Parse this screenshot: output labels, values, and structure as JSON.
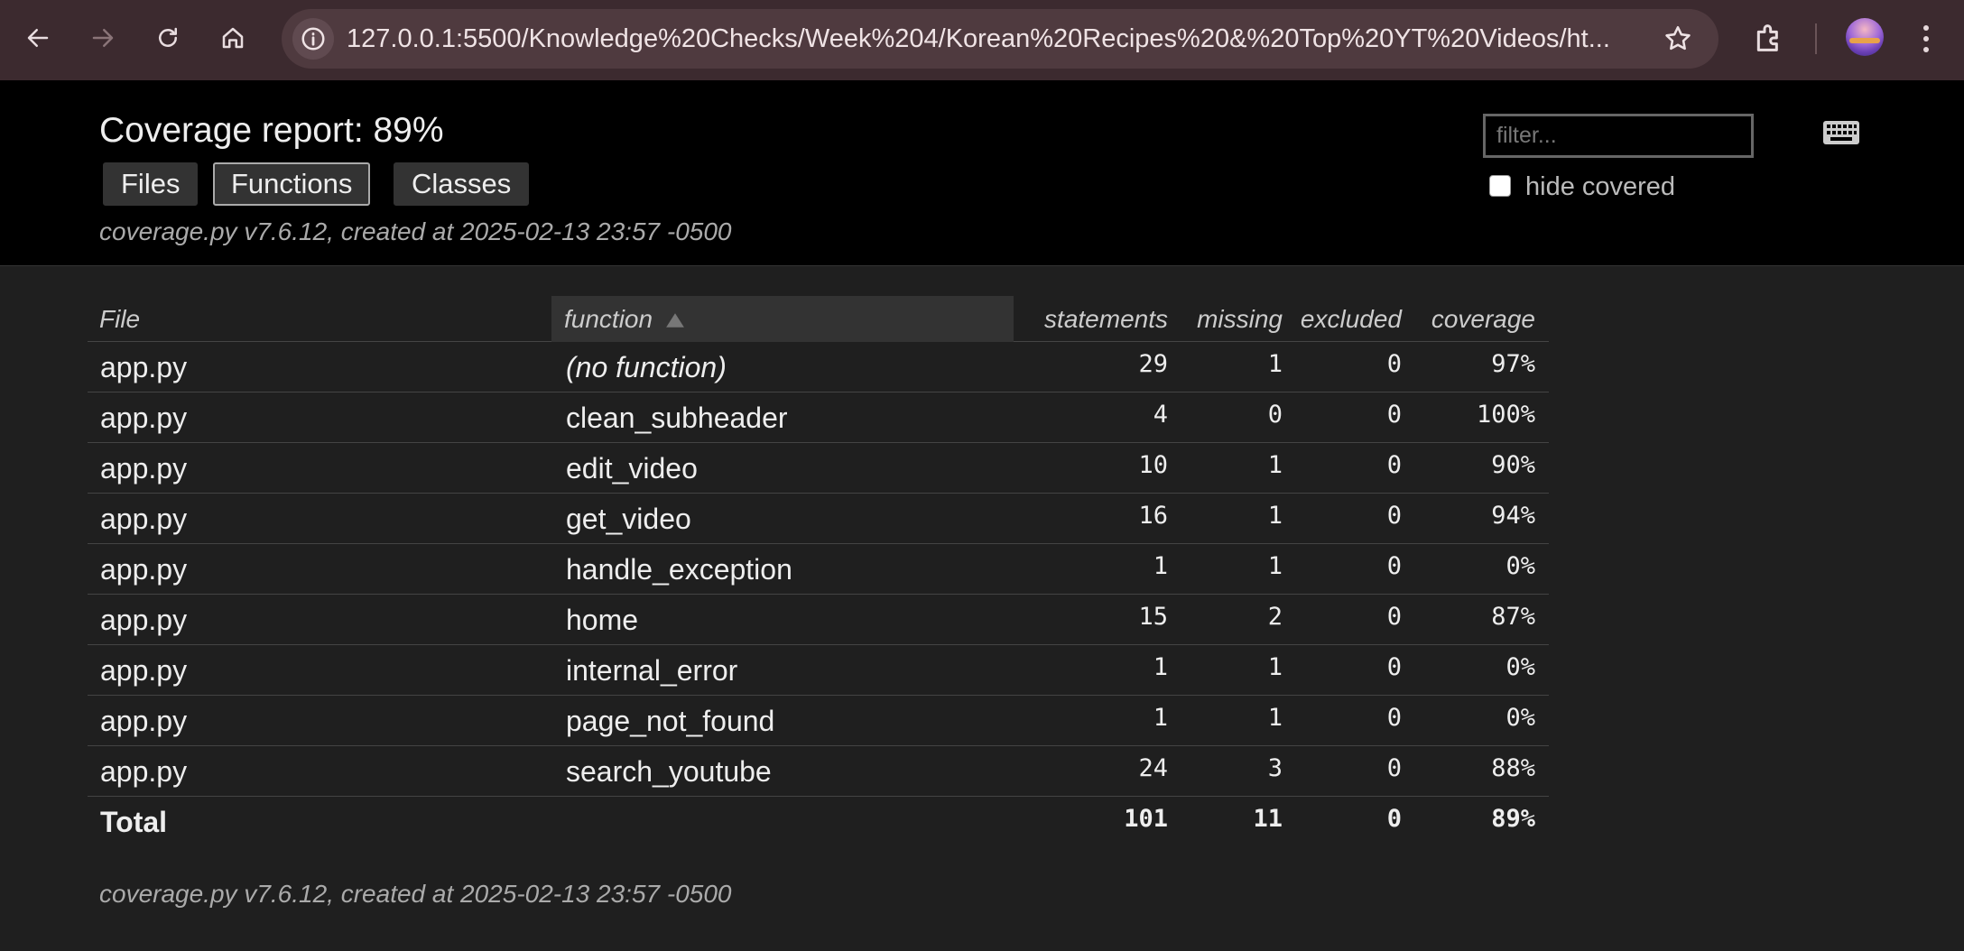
{
  "browser": {
    "url": "127.0.0.1:5500/Knowledge%20Checks/Week%204/Korean%20Recipes%20&%20Top%20YT%20Videos/ht...",
    "icons": [
      "back-arrow-icon",
      "forward-arrow-icon",
      "reload-icon",
      "home-icon",
      "site-info-icon",
      "star-icon",
      "extensions-icon",
      "profile-avatar",
      "more-menu-icon"
    ]
  },
  "header": {
    "title": "Coverage report: 89%",
    "tabs": [
      {
        "label": "Files",
        "current": false
      },
      {
        "label": "Functions",
        "current": true
      },
      {
        "label": "Classes",
        "current": false
      }
    ],
    "meta": "coverage.py v7.6.12, created at 2025-02-13 23:57 -0500",
    "filter_placeholder": "filter...",
    "hide_covered_label": "hide covered",
    "hide_covered_checked": false
  },
  "table": {
    "columns": [
      "File",
      "function",
      "statements",
      "missing",
      "excluded",
      "coverage"
    ],
    "sorted_column": "function",
    "sort_direction": "ascending",
    "rows": [
      {
        "file": "app.py",
        "function": "(no function)",
        "statements": "29",
        "missing": "1",
        "excluded": "0",
        "coverage": "97%"
      },
      {
        "file": "app.py",
        "function": "clean_subheader",
        "statements": "4",
        "missing": "0",
        "excluded": "0",
        "coverage": "100%"
      },
      {
        "file": "app.py",
        "function": "edit_video",
        "statements": "10",
        "missing": "1",
        "excluded": "0",
        "coverage": "90%"
      },
      {
        "file": "app.py",
        "function": "get_video",
        "statements": "16",
        "missing": "1",
        "excluded": "0",
        "coverage": "94%"
      },
      {
        "file": "app.py",
        "function": "handle_exception",
        "statements": "1",
        "missing": "1",
        "excluded": "0",
        "coverage": "0%"
      },
      {
        "file": "app.py",
        "function": "home",
        "statements": "15",
        "missing": "2",
        "excluded": "0",
        "coverage": "87%"
      },
      {
        "file": "app.py",
        "function": "internal_error",
        "statements": "1",
        "missing": "1",
        "excluded": "0",
        "coverage": "0%"
      },
      {
        "file": "app.py",
        "function": "page_not_found",
        "statements": "1",
        "missing": "1",
        "excluded": "0",
        "coverage": "0%"
      },
      {
        "file": "app.py",
        "function": "search_youtube",
        "statements": "24",
        "missing": "3",
        "excluded": "0",
        "coverage": "88%"
      }
    ],
    "total": {
      "label": "Total",
      "statements": "101",
      "missing": "11",
      "excluded": "0",
      "coverage": "89%"
    }
  },
  "footer": {
    "meta": "coverage.py v7.6.12, created at 2025-02-13 23:57 -0500"
  },
  "colors": {
    "chrome_bg": "#3c2a2f",
    "omnibox_bg": "#4f3a3f",
    "header_bg": "#000000",
    "page_bg": "#1f1f1f"
  }
}
